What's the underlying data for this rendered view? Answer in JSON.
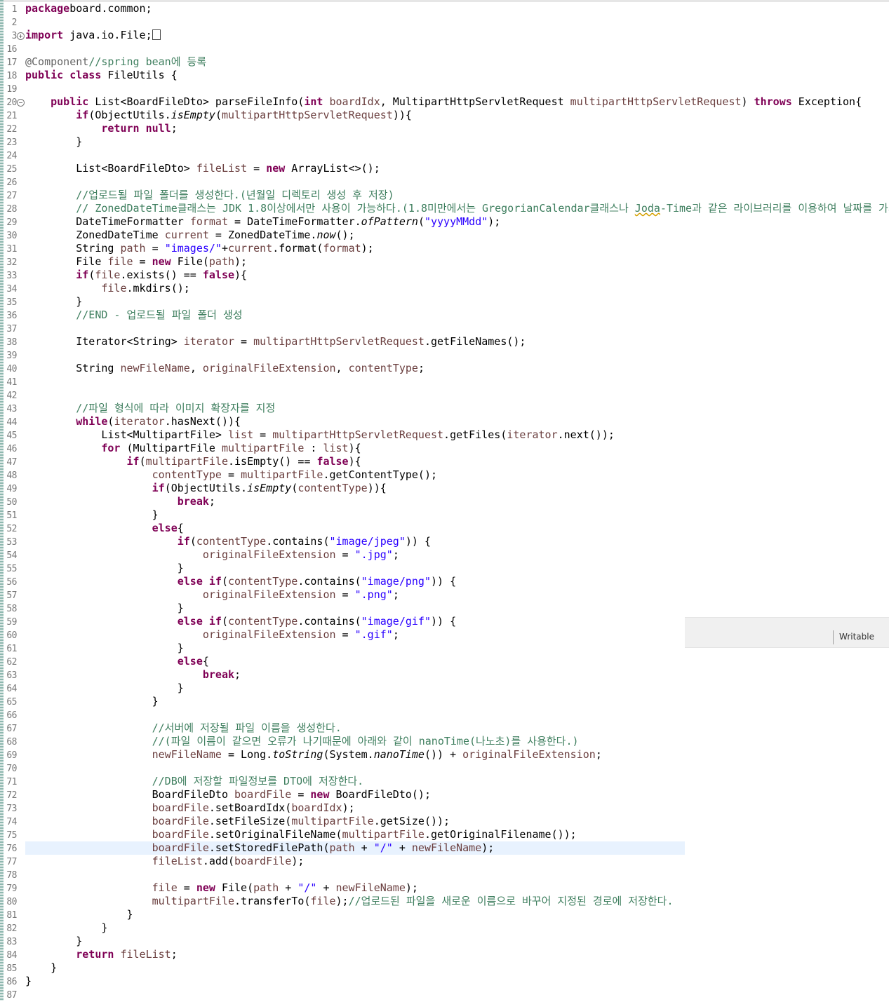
{
  "status": {
    "mode": "Writable"
  },
  "colors": {
    "keyword": "#7f0055",
    "field": "#0000c0",
    "string": "#2a00ff",
    "comment": "#3f7f5f",
    "annotation": "#646464",
    "current_line": "#e8f2fe"
  },
  "lines": [
    {
      "n": "1",
      "t": [
        [
          "k",
          "package"
        ],
        [
          "",
          "board.common;"
        ]
      ]
    },
    {
      "n": "2",
      "t": []
    },
    {
      "n": "3",
      "marker": "+",
      "t": [
        [
          "k",
          "import"
        ],
        [
          "",
          " java.io.File;"
        ],
        [
          "box",
          ""
        ]
      ]
    },
    {
      "n": "16",
      "t": []
    },
    {
      "n": "17",
      "t": [
        [
          "a",
          "@Component"
        ],
        [
          "c",
          "//spring bean에 등록"
        ]
      ]
    },
    {
      "n": "18",
      "t": [
        [
          "k",
          "public class"
        ],
        [
          "",
          " FileUtils {"
        ]
      ]
    },
    {
      "n": "19",
      "t": []
    },
    {
      "n": "20",
      "marker": "−",
      "t": [
        [
          "",
          "    "
        ],
        [
          "k",
          "public"
        ],
        [
          "",
          " List<BoardFileDto> parseFileInfo("
        ],
        [
          "k",
          "int"
        ],
        [
          "",
          " "
        ],
        [
          "vf",
          "boardIdx"
        ],
        [
          "",
          ", MultipartHttpServletRequest "
        ],
        [
          "vf",
          "multipartHttpServletRequest"
        ],
        [
          "",
          ") "
        ],
        [
          "k",
          "throws"
        ],
        [
          "",
          " Exception{"
        ]
      ]
    },
    {
      "n": "21",
      "t": [
        [
          "",
          "        "
        ],
        [
          "k",
          "if"
        ],
        [
          "",
          "(ObjectUtils."
        ],
        [
          "i",
          "isEmpty"
        ],
        [
          "",
          "("
        ],
        [
          "vf",
          "multipartHttpServletRequest"
        ],
        [
          "",
          ")){"
        ]
      ]
    },
    {
      "n": "22",
      "t": [
        [
          "",
          "            "
        ],
        [
          "k",
          "return null"
        ],
        [
          "",
          ";"
        ]
      ]
    },
    {
      "n": "23",
      "t": [
        [
          "",
          "        }"
        ]
      ]
    },
    {
      "n": "24",
      "t": []
    },
    {
      "n": "25",
      "t": [
        [
          "",
          "        List<BoardFileDto> "
        ],
        [
          "vf",
          "fileList"
        ],
        [
          "",
          " = "
        ],
        [
          "k",
          "new"
        ],
        [
          "",
          " ArrayList<>();"
        ]
      ]
    },
    {
      "n": "26",
      "t": []
    },
    {
      "n": "27",
      "t": [
        [
          "",
          "        "
        ],
        [
          "c",
          "//업로드될 파일 폴더를 생성한다.(년월일 디렉토리 생성 후 저장)"
        ]
      ]
    },
    {
      "n": "28",
      "t": [
        [
          "",
          "        "
        ],
        [
          "c",
          "// ZonedDateTime클래스는 JDK 1.8이상에서만 사용이 가능하다.(1.8미만에서는 GregorianCalendar클래스나 "
        ],
        [
          "csq",
          "Joda"
        ],
        [
          "c",
          "-Time과 같은 라이브러리를 이용하여 날짜를 가져온다.)"
        ]
      ]
    },
    {
      "n": "29",
      "t": [
        [
          "",
          "        DateTimeFormatter "
        ],
        [
          "vf",
          "format"
        ],
        [
          "",
          " = DateTimeFormatter."
        ],
        [
          "i",
          "ofPattern"
        ],
        [
          "",
          "("
        ],
        [
          "s",
          "\"yyyyMMdd\""
        ],
        [
          "",
          ");"
        ]
      ]
    },
    {
      "n": "30",
      "t": [
        [
          "",
          "        ZonedDateTime "
        ],
        [
          "vf",
          "current"
        ],
        [
          "",
          " = ZonedDateTime."
        ],
        [
          "i",
          "now"
        ],
        [
          "",
          "();"
        ]
      ]
    },
    {
      "n": "31",
      "t": [
        [
          "",
          "        String "
        ],
        [
          "vf",
          "path"
        ],
        [
          "",
          " = "
        ],
        [
          "s",
          "\"images/\""
        ],
        [
          "",
          "+"
        ],
        [
          "vf",
          "current"
        ],
        [
          "",
          ".format("
        ],
        [
          "vf",
          "format"
        ],
        [
          "",
          ");"
        ]
      ]
    },
    {
      "n": "32",
      "t": [
        [
          "",
          "        File "
        ],
        [
          "vf",
          "file"
        ],
        [
          "",
          " = "
        ],
        [
          "k",
          "new"
        ],
        [
          "",
          " File("
        ],
        [
          "vf",
          "path"
        ],
        [
          "",
          ");"
        ]
      ]
    },
    {
      "n": "33",
      "t": [
        [
          "",
          "        "
        ],
        [
          "k",
          "if"
        ],
        [
          "",
          "("
        ],
        [
          "vf",
          "file"
        ],
        [
          "",
          ".exists() == "
        ],
        [
          "k",
          "false"
        ],
        [
          "",
          "){"
        ]
      ]
    },
    {
      "n": "34",
      "t": [
        [
          "",
          "            "
        ],
        [
          "vf",
          "file"
        ],
        [
          "",
          ".mkdirs();"
        ]
      ]
    },
    {
      "n": "35",
      "t": [
        [
          "",
          "        }"
        ]
      ]
    },
    {
      "n": "36",
      "t": [
        [
          "",
          "        "
        ],
        [
          "c",
          "//END - 업로드될 파일 폴더 생성"
        ]
      ]
    },
    {
      "n": "37",
      "t": []
    },
    {
      "n": "38",
      "t": [
        [
          "",
          "        Iterator<String> "
        ],
        [
          "vf",
          "iterator"
        ],
        [
          "",
          " = "
        ],
        [
          "vf",
          "multipartHttpServletRequest"
        ],
        [
          "",
          ".getFileNames();"
        ]
      ]
    },
    {
      "n": "39",
      "t": []
    },
    {
      "n": "40",
      "t": [
        [
          "",
          "        String "
        ],
        [
          "vf",
          "newFileName"
        ],
        [
          "",
          ", "
        ],
        [
          "vf",
          "originalFileExtension"
        ],
        [
          "",
          ", "
        ],
        [
          "vf",
          "contentType"
        ],
        [
          "",
          ";"
        ]
      ]
    },
    {
      "n": "41",
      "t": []
    },
    {
      "n": "42",
      "t": []
    },
    {
      "n": "43",
      "t": [
        [
          "",
          "        "
        ],
        [
          "c",
          "//파일 형식에 따라 이미지 확장자를 지정"
        ]
      ]
    },
    {
      "n": "44",
      "t": [
        [
          "",
          "        "
        ],
        [
          "k",
          "while"
        ],
        [
          "",
          "("
        ],
        [
          "vf",
          "iterator"
        ],
        [
          "",
          ".hasNext()){"
        ]
      ]
    },
    {
      "n": "45",
      "t": [
        [
          "",
          "            List<MultipartFile> "
        ],
        [
          "vf",
          "list"
        ],
        [
          "",
          " = "
        ],
        [
          "vf",
          "multipartHttpServletRequest"
        ],
        [
          "",
          ".getFiles("
        ],
        [
          "vf",
          "iterator"
        ],
        [
          "",
          ".next());"
        ]
      ]
    },
    {
      "n": "46",
      "t": [
        [
          "",
          "            "
        ],
        [
          "k",
          "for"
        ],
        [
          "",
          " (MultipartFile "
        ],
        [
          "vf",
          "multipartFile"
        ],
        [
          "",
          " : "
        ],
        [
          "vf",
          "list"
        ],
        [
          "",
          "){"
        ]
      ]
    },
    {
      "n": "47",
      "t": [
        [
          "",
          "                "
        ],
        [
          "k",
          "if"
        ],
        [
          "",
          "("
        ],
        [
          "vf",
          "multipartFile"
        ],
        [
          "",
          ".isEmpty() == "
        ],
        [
          "k",
          "false"
        ],
        [
          "",
          "){"
        ]
      ]
    },
    {
      "n": "48",
      "t": [
        [
          "",
          "                    "
        ],
        [
          "vf",
          "contentType"
        ],
        [
          "",
          " = "
        ],
        [
          "vf",
          "multipartFile"
        ],
        [
          "",
          ".getContentType();"
        ]
      ]
    },
    {
      "n": "49",
      "t": [
        [
          "",
          "                    "
        ],
        [
          "k",
          "if"
        ],
        [
          "",
          "(ObjectUtils."
        ],
        [
          "i",
          "isEmpty"
        ],
        [
          "",
          "("
        ],
        [
          "vf",
          "contentType"
        ],
        [
          "",
          ")){"
        ]
      ]
    },
    {
      "n": "50",
      "t": [
        [
          "",
          "                        "
        ],
        [
          "k",
          "break"
        ],
        [
          "",
          ";"
        ]
      ]
    },
    {
      "n": "51",
      "t": [
        [
          "",
          "                    }"
        ]
      ]
    },
    {
      "n": "52",
      "t": [
        [
          "",
          "                    "
        ],
        [
          "k",
          "else"
        ],
        [
          "",
          "{"
        ]
      ]
    },
    {
      "n": "53",
      "t": [
        [
          "",
          "                        "
        ],
        [
          "k",
          "if"
        ],
        [
          "",
          "("
        ],
        [
          "vf",
          "contentType"
        ],
        [
          "",
          ".contains("
        ],
        [
          "s",
          "\"image/jpeg\""
        ],
        [
          "",
          ")) {"
        ]
      ]
    },
    {
      "n": "54",
      "t": [
        [
          "",
          "                            "
        ],
        [
          "vf",
          "originalFileExtension"
        ],
        [
          "",
          " = "
        ],
        [
          "s",
          "\".jpg\""
        ],
        [
          "",
          ";"
        ]
      ]
    },
    {
      "n": "55",
      "t": [
        [
          "",
          "                        }"
        ]
      ]
    },
    {
      "n": "56",
      "t": [
        [
          "",
          "                        "
        ],
        [
          "k",
          "else if"
        ],
        [
          "",
          "("
        ],
        [
          "vf",
          "contentType"
        ],
        [
          "",
          ".contains("
        ],
        [
          "s",
          "\"image/png\""
        ],
        [
          "",
          ")) {"
        ]
      ]
    },
    {
      "n": "57",
      "t": [
        [
          "",
          "                            "
        ],
        [
          "vf",
          "originalFileExtension"
        ],
        [
          "",
          " = "
        ],
        [
          "s",
          "\".png\""
        ],
        [
          "",
          ";"
        ]
      ]
    },
    {
      "n": "58",
      "t": [
        [
          "",
          "                        }"
        ]
      ]
    },
    {
      "n": "59",
      "t": [
        [
          "",
          "                        "
        ],
        [
          "k",
          "else if"
        ],
        [
          "",
          "("
        ],
        [
          "vf",
          "contentType"
        ],
        [
          "",
          ".contains("
        ],
        [
          "s",
          "\"image/gif\""
        ],
        [
          "",
          ")) {"
        ]
      ]
    },
    {
      "n": "60",
      "t": [
        [
          "",
          "                            "
        ],
        [
          "vf",
          "originalFileExtension"
        ],
        [
          "",
          " = "
        ],
        [
          "s",
          "\".gif\""
        ],
        [
          "",
          ";"
        ]
      ]
    },
    {
      "n": "61",
      "t": [
        [
          "",
          "                        }"
        ]
      ]
    },
    {
      "n": "62",
      "t": [
        [
          "",
          "                        "
        ],
        [
          "k",
          "else"
        ],
        [
          "",
          "{"
        ]
      ]
    },
    {
      "n": "63",
      "t": [
        [
          "",
          "                            "
        ],
        [
          "k",
          "break"
        ],
        [
          "",
          ";"
        ]
      ]
    },
    {
      "n": "64",
      "t": [
        [
          "",
          "                        }"
        ]
      ]
    },
    {
      "n": "65",
      "t": [
        [
          "",
          "                    }"
        ]
      ]
    },
    {
      "n": "66",
      "t": []
    },
    {
      "n": "67",
      "t": [
        [
          "",
          "                    "
        ],
        [
          "c",
          "//서버에 저장될 파일 이름을 생성한다."
        ]
      ]
    },
    {
      "n": "68",
      "t": [
        [
          "",
          "                    "
        ],
        [
          "c",
          "//(파일 이름이 같으면 오류가 나기때문에 아래와 같이 nanoTime(나노초)를 사용한다.)"
        ]
      ]
    },
    {
      "n": "69",
      "t": [
        [
          "",
          "                    "
        ],
        [
          "vf",
          "newFileName"
        ],
        [
          "",
          " = Long."
        ],
        [
          "i",
          "toString"
        ],
        [
          "",
          "(System."
        ],
        [
          "i",
          "nanoTime"
        ],
        [
          "",
          "()) + "
        ],
        [
          "vf",
          "originalFileExtension"
        ],
        [
          "",
          ";"
        ]
      ]
    },
    {
      "n": "70",
      "t": []
    },
    {
      "n": "71",
      "t": [
        [
          "",
          "                    "
        ],
        [
          "c",
          "//DB에 저장할 파일정보를 DTO에 저장한다."
        ]
      ]
    },
    {
      "n": "72",
      "t": [
        [
          "",
          "                    BoardFileDto "
        ],
        [
          "vf",
          "boardFile"
        ],
        [
          "",
          " = "
        ],
        [
          "k",
          "new"
        ],
        [
          "",
          " BoardFileDto();"
        ]
      ]
    },
    {
      "n": "73",
      "t": [
        [
          "",
          "                    "
        ],
        [
          "vf",
          "boardFile"
        ],
        [
          "",
          ".setBoardIdx("
        ],
        [
          "vf",
          "boardIdx"
        ],
        [
          "",
          ");"
        ]
      ]
    },
    {
      "n": "74",
      "t": [
        [
          "",
          "                    "
        ],
        [
          "vf",
          "boardFile"
        ],
        [
          "",
          ".setFileSize("
        ],
        [
          "vf",
          "multipartFile"
        ],
        [
          "",
          ".getSize());"
        ]
      ]
    },
    {
      "n": "75",
      "t": [
        [
          "",
          "                    "
        ],
        [
          "vf",
          "boardFile"
        ],
        [
          "",
          ".setOriginalFileName("
        ],
        [
          "vf",
          "multipartFile"
        ],
        [
          "",
          ".getOriginalFilename());"
        ]
      ]
    },
    {
      "n": "76",
      "current": true,
      "t": [
        [
          "",
          "                    "
        ],
        [
          "vf",
          "boardFile"
        ],
        [
          "",
          ".setStoredFilePath("
        ],
        [
          "vf",
          "path"
        ],
        [
          "",
          " + "
        ],
        [
          "s",
          "\"/\""
        ],
        [
          "",
          " + "
        ],
        [
          "vf",
          "newFileName"
        ],
        [
          "",
          ");"
        ]
      ]
    },
    {
      "n": "77",
      "t": [
        [
          "",
          "                    "
        ],
        [
          "vf",
          "fileList"
        ],
        [
          "",
          ".add("
        ],
        [
          "vf",
          "boardFile"
        ],
        [
          "",
          ");"
        ]
      ]
    },
    {
      "n": "78",
      "t": []
    },
    {
      "n": "79",
      "t": [
        [
          "",
          "                    "
        ],
        [
          "vf",
          "file"
        ],
        [
          "",
          " = "
        ],
        [
          "k",
          "new"
        ],
        [
          "",
          " File("
        ],
        [
          "vf",
          "path"
        ],
        [
          "",
          " + "
        ],
        [
          "s",
          "\"/\""
        ],
        [
          "",
          " + "
        ],
        [
          "vf",
          "newFileName"
        ],
        [
          "",
          ");"
        ]
      ]
    },
    {
      "n": "80",
      "t": [
        [
          "",
          "                    "
        ],
        [
          "vf",
          "multipartFile"
        ],
        [
          "",
          ".transferTo("
        ],
        [
          "vf",
          "file"
        ],
        [
          "",
          ");"
        ],
        [
          "c",
          "//업로드된 파일을 새로운 이름으로 바꾸어 지정된 경로에 저장한다."
        ]
      ]
    },
    {
      "n": "81",
      "t": [
        [
          "",
          "                }"
        ]
      ]
    },
    {
      "n": "82",
      "t": [
        [
          "",
          "            }"
        ]
      ]
    },
    {
      "n": "83",
      "t": [
        [
          "",
          "        }"
        ]
      ]
    },
    {
      "n": "84",
      "t": [
        [
          "",
          "        "
        ],
        [
          "k",
          "return"
        ],
        [
          "",
          " "
        ],
        [
          "vf",
          "fileList"
        ],
        [
          "",
          ";"
        ]
      ]
    },
    {
      "n": "85",
      "t": [
        [
          "",
          "    }"
        ]
      ]
    },
    {
      "n": "86",
      "t": [
        [
          "",
          "}"
        ]
      ]
    },
    {
      "n": "87",
      "t": []
    }
  ]
}
